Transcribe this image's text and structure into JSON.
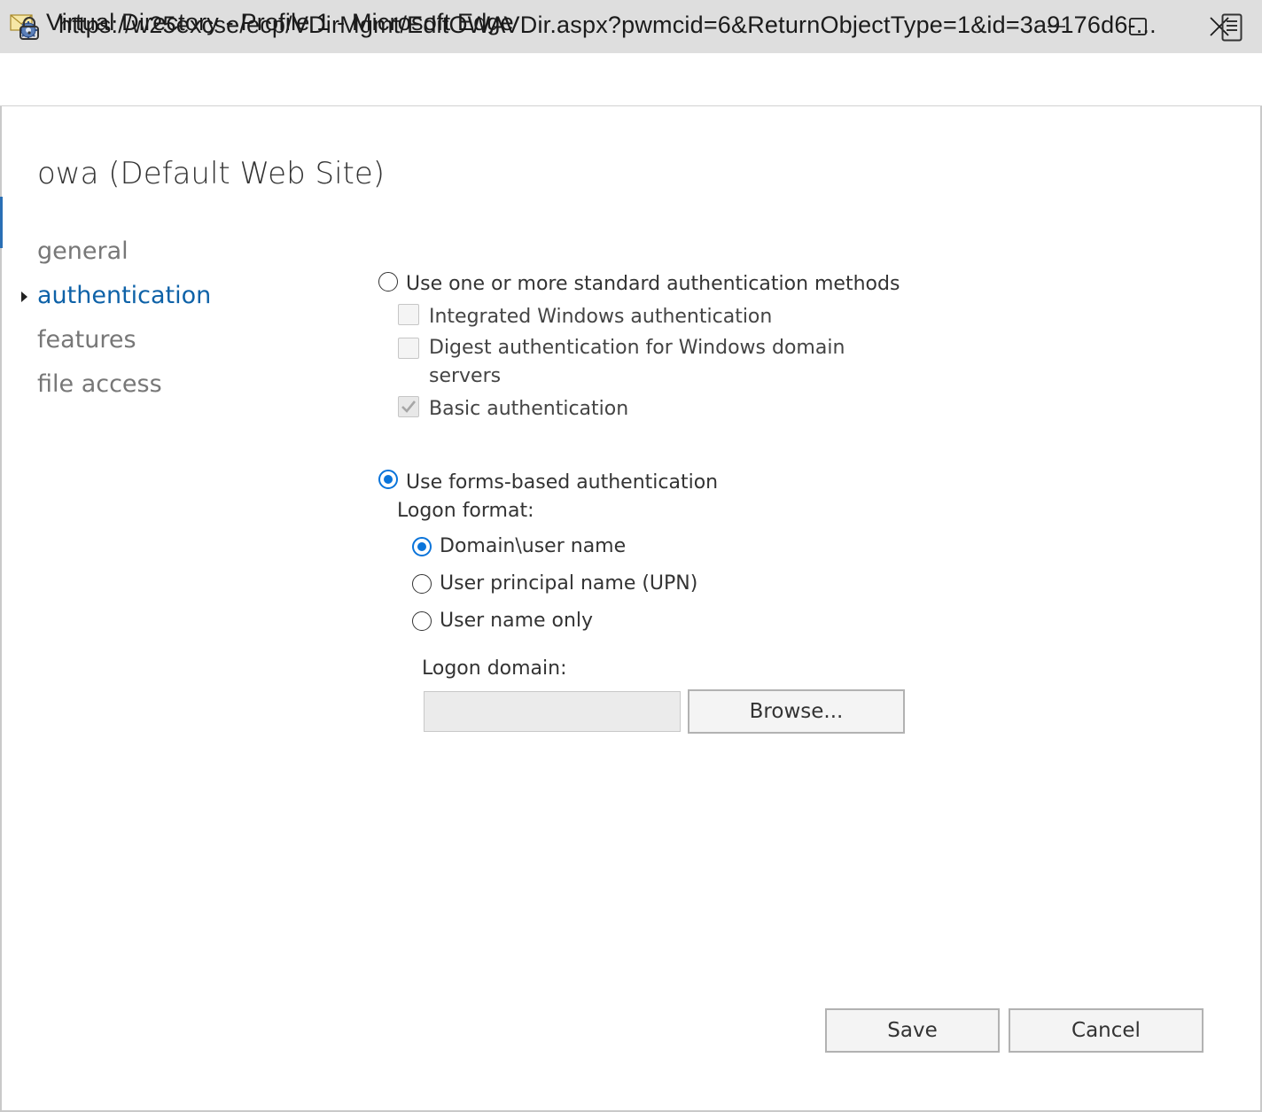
{
  "window": {
    "title": "Virtual Directory - Profile 1 - Microsoft Edge",
    "url": "https://w25excse/ecp/VDirMgmt/EditOWAVDir.aspx?pwmcid=6&ReturnObjectType=1&id=3a9176d6-..."
  },
  "page": {
    "title": "owa (Default Web Site)"
  },
  "nav": {
    "items": [
      {
        "label": "general"
      },
      {
        "label": "authentication"
      },
      {
        "label": "features"
      },
      {
        "label": "file access"
      }
    ],
    "selected": "authentication"
  },
  "auth": {
    "standard_label": "Use one or more standard authentication methods",
    "standard_selected": false,
    "integrated_label": "Integrated Windows authentication",
    "integrated_checked": false,
    "digest_label_line1": "Digest authentication for Windows domain",
    "digest_label_line2": "servers",
    "digest_checked": false,
    "basic_label": "Basic authentication",
    "basic_checked": true,
    "forms_label": "Use forms-based authentication",
    "forms_selected": true,
    "logon_format_label": "Logon format:",
    "formats": [
      {
        "label": "Domain\\user name",
        "selected": true
      },
      {
        "label": "User principal name (UPN)",
        "selected": false
      },
      {
        "label": "User name only",
        "selected": false
      }
    ],
    "logon_domain_label": "Logon domain:",
    "logon_domain_value": "",
    "browse_label": "Browse..."
  },
  "footer": {
    "save_label": "Save",
    "cancel_label": "Cancel"
  },
  "colors": {
    "accent": "#0a74da",
    "nav_selected": "#0e62a8",
    "titlebar": "#dedede"
  }
}
